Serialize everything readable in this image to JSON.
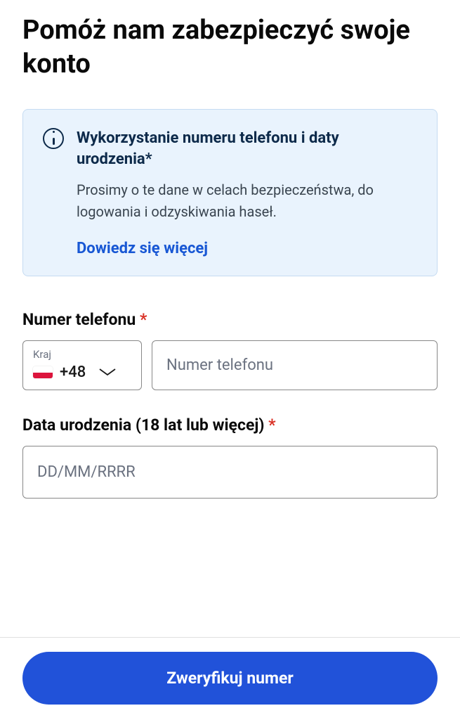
{
  "page": {
    "title": "Pomóż nam zabezpieczyć swoje konto"
  },
  "info": {
    "title": "Wykorzystanie numeru telefonu i daty urodzenia*",
    "description": "Prosimy o te dane w celach bezpieczeństwa, do logowania i odzyskiwania haseł.",
    "link_text": "Dowiedz się więcej"
  },
  "phone": {
    "label": "Numer telefonu",
    "required_star": "*",
    "country_label": "Kraj",
    "dial_code": "+48",
    "placeholder": "Numer telefonu"
  },
  "dob": {
    "label": "Data urodzenia (18 lat lub więcej)",
    "required_star": "*",
    "placeholder": "DD/MM/RRRR"
  },
  "footer": {
    "button_text": "Zweryfikuj numer"
  }
}
